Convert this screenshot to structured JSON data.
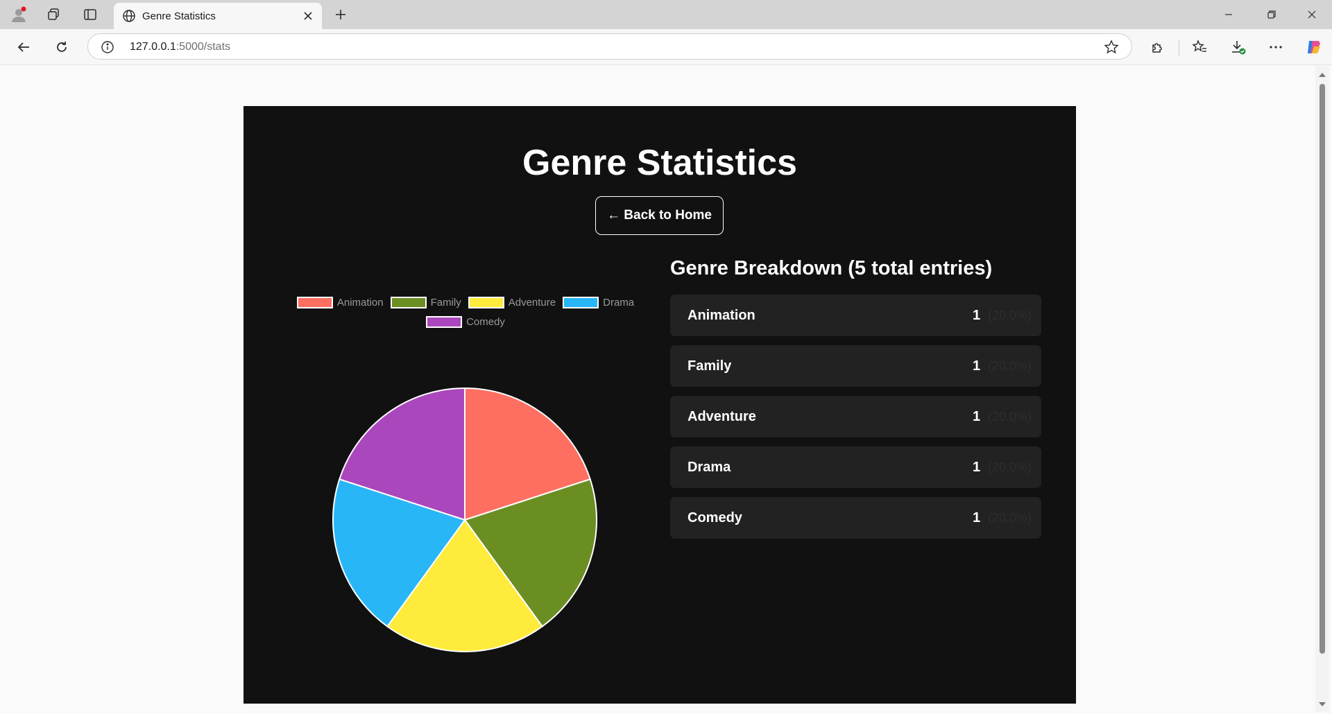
{
  "browser": {
    "tab_title": "Genre Statistics",
    "url_host": "127.0.0.1",
    "url_rest": ":5000/stats"
  },
  "page": {
    "title": "Genre Statistics",
    "back_button": "← Back to Home",
    "breakdown_title": "Genre Breakdown (5 total entries)",
    "background": "#111111"
  },
  "genres": [
    {
      "name": "Animation",
      "count": "1",
      "percent": "(20.0%)"
    },
    {
      "name": "Family",
      "count": "1",
      "percent": "(20.0%)"
    },
    {
      "name": "Adventure",
      "count": "1",
      "percent": "(20.0%)"
    },
    {
      "name": "Drama",
      "count": "1",
      "percent": "(20.0%)"
    },
    {
      "name": "Comedy",
      "count": "1",
      "percent": "(20.0%)"
    }
  ],
  "chart_data": {
    "type": "pie",
    "categories": [
      "Animation",
      "Family",
      "Adventure",
      "Drama",
      "Comedy"
    ],
    "values": [
      1,
      1,
      1,
      1,
      1
    ],
    "colors": [
      "#ff6f61",
      "#6b8e23",
      "#ffeb3b",
      "#29b6f6",
      "#ab47bc"
    ],
    "legend_position": "top"
  }
}
